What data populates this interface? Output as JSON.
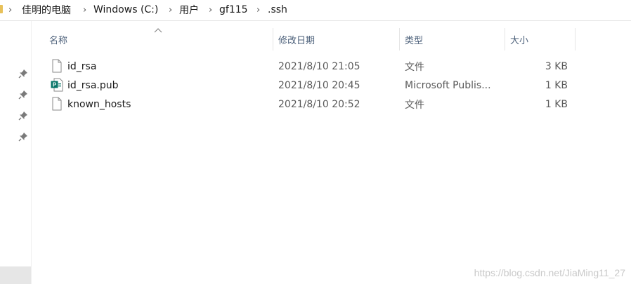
{
  "breadcrumb": {
    "items": [
      "佳明的电脑",
      "Windows (C:)",
      "用户",
      "gf115",
      ".ssh"
    ]
  },
  "columns": {
    "name": "名称",
    "modified": "修改日期",
    "type": "类型",
    "size": "大小",
    "sorted_by": "name",
    "sort_direction": "ascending"
  },
  "files": [
    {
      "name": "id_rsa",
      "modified": "2021/8/10 21:05",
      "type": "文件",
      "size": "3 KB",
      "icon": "blank-file-icon"
    },
    {
      "name": "id_rsa.pub",
      "modified": "2021/8/10 20:45",
      "type": "Microsoft Publis...",
      "size": "1 KB",
      "icon": "publisher-file-icon"
    },
    {
      "name": "known_hosts",
      "modified": "2021/8/10 20:52",
      "type": "文件",
      "size": "1 KB",
      "icon": "blank-file-icon"
    }
  ],
  "watermark": "https://blog.csdn.net/JiaMing11_27",
  "colors": {
    "header_text": "#4c607a",
    "publisher_green": "#077568"
  }
}
